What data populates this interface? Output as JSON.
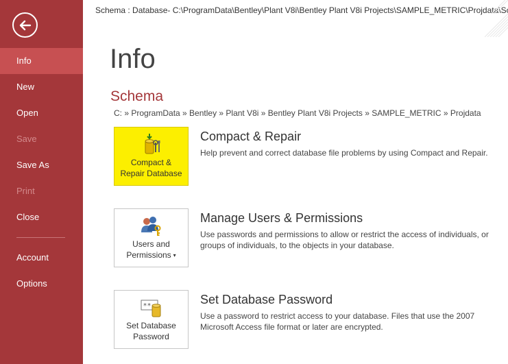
{
  "window": {
    "title_path": "Schema : Database- C:\\ProgramData\\Bentley\\Plant V8i\\Bentley Plant V8i Projects\\SAMPLE_METRIC\\Projdata\\Schema"
  },
  "sidebar": {
    "back_icon": "back-arrow-icon",
    "items": [
      {
        "label": "Info",
        "state": "active"
      },
      {
        "label": "New",
        "state": "normal"
      },
      {
        "label": "Open",
        "state": "normal"
      },
      {
        "label": "Save",
        "state": "disabled"
      },
      {
        "label": "Save As",
        "state": "normal"
      },
      {
        "label": "Print",
        "state": "disabled"
      },
      {
        "label": "Close",
        "state": "normal"
      },
      {
        "label": "Account",
        "state": "normal"
      },
      {
        "label": "Options",
        "state": "normal"
      }
    ]
  },
  "main": {
    "title": "Info",
    "section_title": "Schema",
    "breadcrumb": "C: » ProgramData » Bentley » Plant V8i » Bentley Plant V8i Projects » SAMPLE_METRIC » Projdata",
    "actions": [
      {
        "button_line1": "Compact &",
        "button_line2": "Repair Database",
        "title": "Compact & Repair",
        "description": "Help prevent and correct database file problems by using Compact and Repair.",
        "icon": "compact-repair-icon"
      },
      {
        "button_line1": "Users and",
        "button_line2": "Permissions",
        "title": "Manage Users & Permissions",
        "description": "Use passwords and permissions to allow or restrict the access of individuals, or groups of individuals, to the objects in your database.",
        "icon": "users-icon"
      },
      {
        "button_line1": "Set Database",
        "button_line2": "Password",
        "title": "Set Database Password",
        "description": "Use a password to restrict access to your database. Files that use the 2007 Microsoft Access file format or later are encrypted.",
        "icon": "database-password-icon"
      }
    ]
  },
  "colors": {
    "sidebar_bg": "#a4373a",
    "sidebar_active": "#c75052",
    "accent_title": "#a4373a",
    "highlight_button": "#fcef00"
  }
}
